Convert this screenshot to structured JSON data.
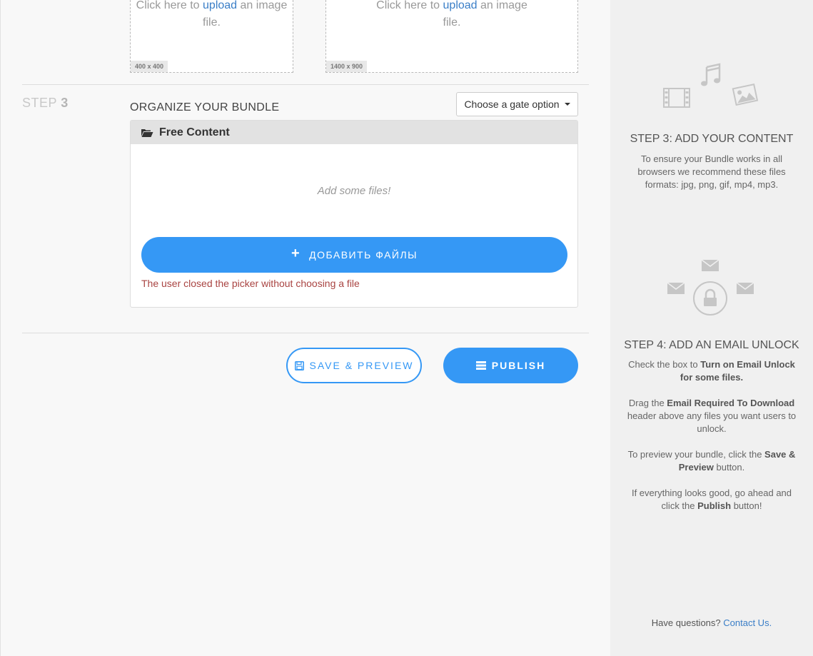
{
  "uploads": [
    {
      "prefix": "Click here to",
      "link": "upload",
      "suffix": "an image file.",
      "size": "400 x 400"
    },
    {
      "prefix": "Click here to",
      "link": "upload",
      "suffix": "an image file.",
      "size": "1400 x 900"
    }
  ],
  "step3": {
    "label_word": "STEP",
    "label_num": "3",
    "title": "ORGANIZE YOUR BUNDLE",
    "gate_option": "Choose a gate option",
    "panel_title": "Free Content",
    "empty_text": "Add some files!",
    "add_files": "ДОБАВИТЬ ФАЙЛЫ",
    "error": "The user closed the picker without choosing a file"
  },
  "actions": {
    "save_preview": "SAVE & PREVIEW",
    "publish": "PUBLISH"
  },
  "sidebar": {
    "content": {
      "title": "STEP 3: ADD YOUR CONTENT",
      "text": "To ensure your Bundle works in all browsers we recommend these files formats: jpg, png, gif, mp4, mp3."
    },
    "unlock": {
      "title": "STEP 4: ADD AN EMAIL UNLOCK",
      "p1_a": "Check the box to ",
      "p1_b": "Turn on Email Unlock for some files.",
      "p2_a": "Drag the ",
      "p2_b": "Email Required To Download",
      "p2_c": " header above any files you want users to unlock.",
      "p3_a": "To preview your bundle, click the ",
      "p3_b": "Save & Preview",
      "p3_c": " button.",
      "p4_a": "If everything looks good, go ahead and click the ",
      "p4_b": "Publish",
      "p4_c": " button!"
    },
    "footer_q": "Have questions?",
    "footer_link": "Contact Us."
  },
  "colors": {
    "accent": "#3598f5",
    "error": "#a94442",
    "link": "#3a7ec7"
  }
}
